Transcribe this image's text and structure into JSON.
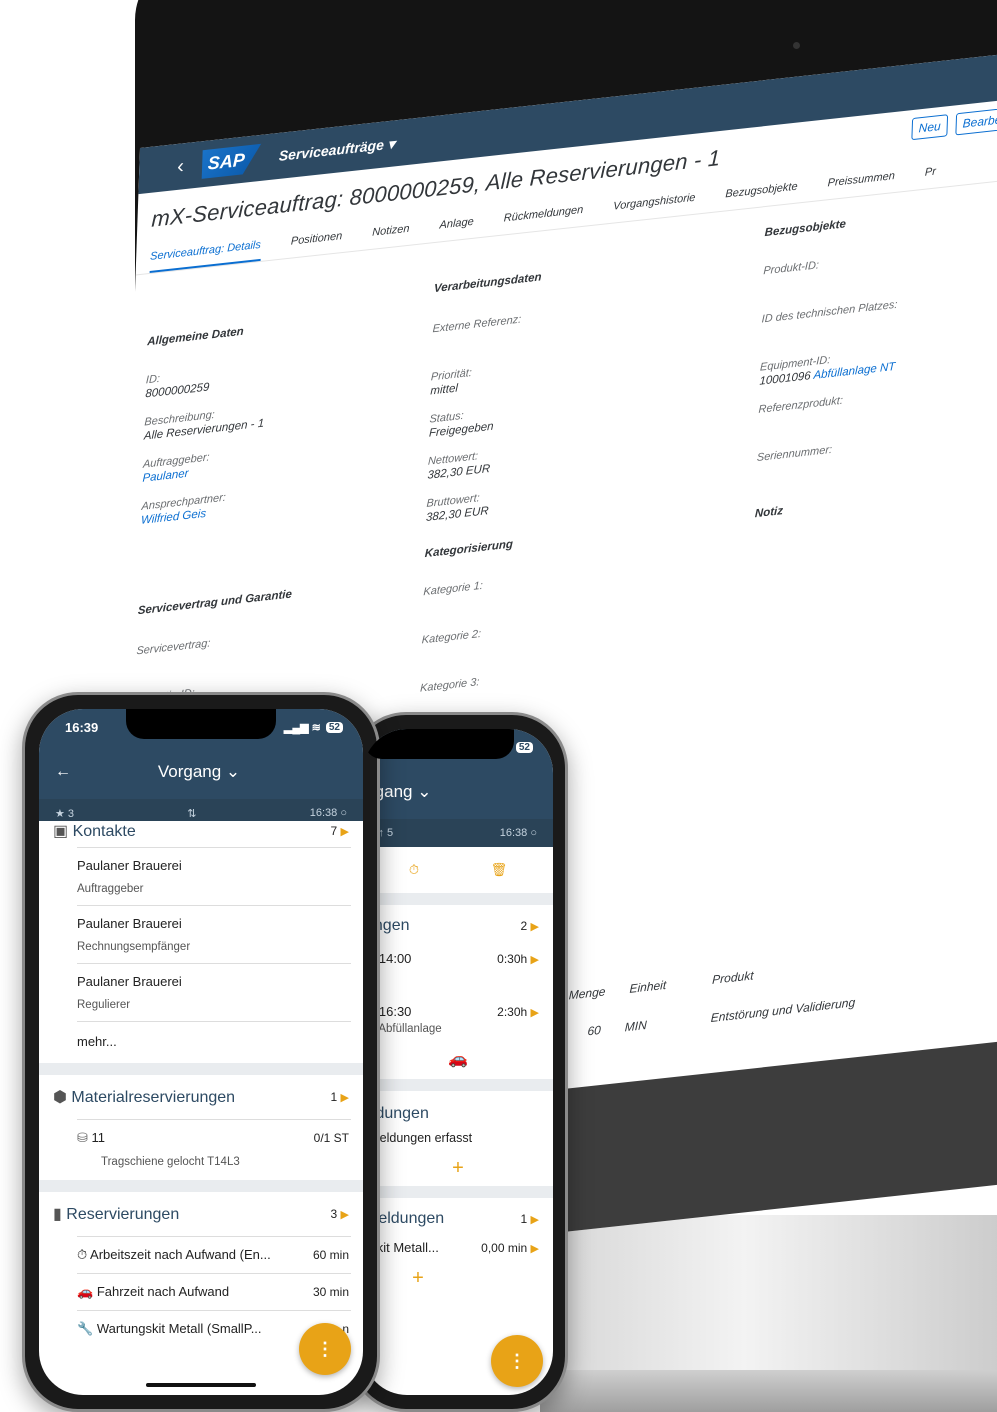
{
  "desktop": {
    "shell": {
      "back_icon": "chevron-left-icon",
      "logo": "SAP",
      "title": "Serviceaufträge ▾"
    },
    "object_title": "mX-Serviceauftrag: 8000000259, Alle Reservierungen - 1",
    "actions": [
      "Neu",
      "Bearbeiten"
    ],
    "tabs": [
      "Serviceauftrag: Details",
      "Positionen",
      "Notizen",
      "Anlage",
      "Rückmeldungen",
      "Vorgangshistorie",
      "Bezugsobjekte",
      "Preissummen",
      "Pr"
    ],
    "allgemeine": {
      "title": "Allgemeine Daten",
      "id_label": "ID:",
      "id_value": "8000000259",
      "desc_label": "Beschreibung:",
      "desc_value": "Alle Reservierungen - 1",
      "auftraggeber_label": "Auftraggeber:",
      "auftraggeber_value": "Paulaner",
      "ansprech_label": "Ansprechpartner:",
      "ansprech_value": "Wilfried Geis"
    },
    "verarbeitung": {
      "title": "Verarbeitungsdaten",
      "extref_label": "Externe Referenz:",
      "prio_label": "Priorität:",
      "prio_value": "mittel",
      "status_label": "Status:",
      "status_value": "Freigegeben",
      "netto_label": "Nettowert:",
      "netto_value": "382,30  EUR",
      "brutto_label": "Bruttowert:",
      "brutto_value": "382,30  EUR"
    },
    "bezug": {
      "title": "Bezugsobjekte",
      "produkt_label": "Produkt-ID:",
      "platz_label": "ID des technischen Platzes:",
      "equip_label": "Equipment-ID:",
      "equip_value": "10001096",
      "equip_link": "Abfüllanlage NT",
      "ref_label": "Referenzprodukt:",
      "serien_label": "Seriennummer:",
      "notiz_title": "Notiz"
    },
    "vertrag": {
      "title": "Servicevertrag und Garantie",
      "sv_label": "Servicevertrag:",
      "garantie_label": "Garantie-ID:"
    },
    "kategorisierung": {
      "title": "Kategorisierung",
      "k1": "Kategorie 1:",
      "k2": "Kategorie 2:",
      "k3": "Kategorie 3:"
    },
    "items_table": {
      "headers": [
        "Menge",
        "Einheit",
        "Produkt"
      ],
      "row": [
        "60",
        "MIN",
        "Entstörung und Validierung"
      ]
    }
  },
  "phone_front": {
    "time": "16:39",
    "battery": "52",
    "title": "Vorgang ⌄",
    "back_icon": "arrow-left-icon",
    "sub_left": "★ 3",
    "sub_right": "16:38 ○",
    "kontakte": {
      "title": "Kontakte",
      "count": "7"
    },
    "contacts": [
      {
        "name": "Paulaner Brauerei",
        "role": "Auftraggeber"
      },
      {
        "name": "Paulaner Brauerei",
        "role": "Rechnungsempfänger"
      },
      {
        "name": "Paulaner Brauerei",
        "role": "Regulierer"
      }
    ],
    "mehr": "mehr...",
    "material": {
      "title": "Materialreservierungen",
      "count": "1",
      "item_id": "11",
      "qty": "0/1 ST",
      "desc": "Tragschiene gelocht T14L3"
    },
    "reserv": {
      "title": "Reservierungen",
      "count": "3",
      "items": [
        {
          "label": "Arbeitszeit nach Aufwand (En...",
          "value": "60 min"
        },
        {
          "label": "Fahrzeit nach Aufwand",
          "value": "30 min"
        },
        {
          "label": "Wartungskit Metall (SmallP...",
          "value": "n"
        }
      ]
    },
    "fab": "⋮"
  },
  "phone_back": {
    "title": "rgang ⌄",
    "sub_left": "↓↑ 5",
    "sub_right": "16:38 ○",
    "battery": "52",
    "ungen": {
      "title": "ungen",
      "count": "2"
    },
    "times": [
      {
        "time": ") - 14:00",
        "dur": "0:30h",
        "sub": ""
      },
      {
        "time": ") - 16:30",
        "dur": "2:30h",
        "sub": "ue Abfüllanlage"
      }
    ],
    "eldungen": {
      "title": "eldungen",
      "sub": "kmeldungen erfasst",
      "add": "+"
    },
    "meldungen": {
      "title": "meldungen",
      "count": "1",
      "item": "gskit Metall...",
      "item_val": "0,00 min"
    },
    "add2": "+",
    "fab": "⋮"
  }
}
